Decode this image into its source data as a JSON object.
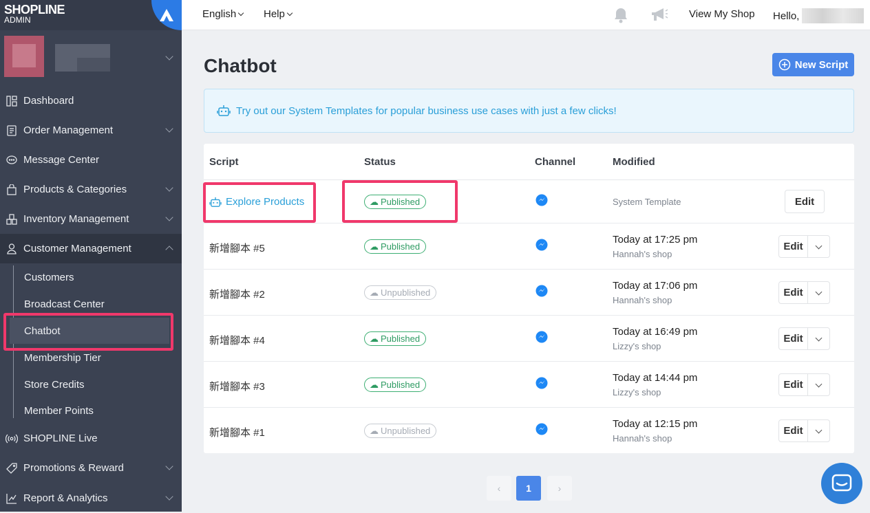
{
  "brand": {
    "logo": "SHOPLINE",
    "sub": "ADMIN"
  },
  "sidebar": {
    "items": [
      {
        "label": "Dashboard",
        "icon": "dashboard-icon"
      },
      {
        "label": "Order Management",
        "icon": "order-icon"
      },
      {
        "label": "Message Center",
        "icon": "message-icon"
      },
      {
        "label": "Products & Categories",
        "icon": "bag-icon"
      },
      {
        "label": "Inventory Management",
        "icon": "inventory-icon"
      },
      {
        "label": "Customer Management",
        "icon": "user-icon"
      },
      {
        "label": "SHOPLINE Live",
        "icon": "live-icon"
      },
      {
        "label": "Promotions & Reward",
        "icon": "tag-icon"
      },
      {
        "label": "Report & Analytics",
        "icon": "chart-icon"
      }
    ],
    "customer_sub": [
      "Customers",
      "Broadcast Center",
      "Chatbot",
      "Membership Tier",
      "Store Credits",
      "Member Points"
    ]
  },
  "topbar": {
    "language": "English",
    "help": "Help",
    "view_shop": "View My Shop",
    "hello": "Hello,"
  },
  "page": {
    "title": "Chatbot",
    "new_button": "New Script"
  },
  "banner": {
    "text": "Try out our System Templates for popular business use cases with just a few clicks!"
  },
  "table": {
    "headers": {
      "script": "Script",
      "status": "Status",
      "channel": "Channel",
      "modified": "Modified"
    },
    "edit_label": "Edit",
    "rows": [
      {
        "name": "Explore Products",
        "status": "Published",
        "modified": "System Template",
        "shop": ""
      },
      {
        "name": "新增腳本 #5",
        "status": "Published",
        "modified": "Today at 17:25 pm",
        "shop": "Hannah's shop"
      },
      {
        "name": "新增腳本 #2",
        "status": "Unpublished",
        "modified": "Today at 17:06 pm",
        "shop": "Hannah's shop"
      },
      {
        "name": "新增腳本 #4",
        "status": "Published",
        "modified": "Today at 16:49 pm",
        "shop": "Lizzy's shop"
      },
      {
        "name": "新增腳本 #3",
        "status": "Published",
        "modified": "Today at 14:44 pm",
        "shop": "Lizzy's shop"
      },
      {
        "name": "新增腳本 #1",
        "status": "Unpublished",
        "modified": "Today at 12:15 pm",
        "shop": "Hannah's shop"
      }
    ]
  },
  "pagination": {
    "current": "1"
  },
  "colors": {
    "accent": "#4a86e8",
    "sidebar": "#3b4252",
    "highlight": "#f0386b",
    "published": "#2e9b62"
  }
}
